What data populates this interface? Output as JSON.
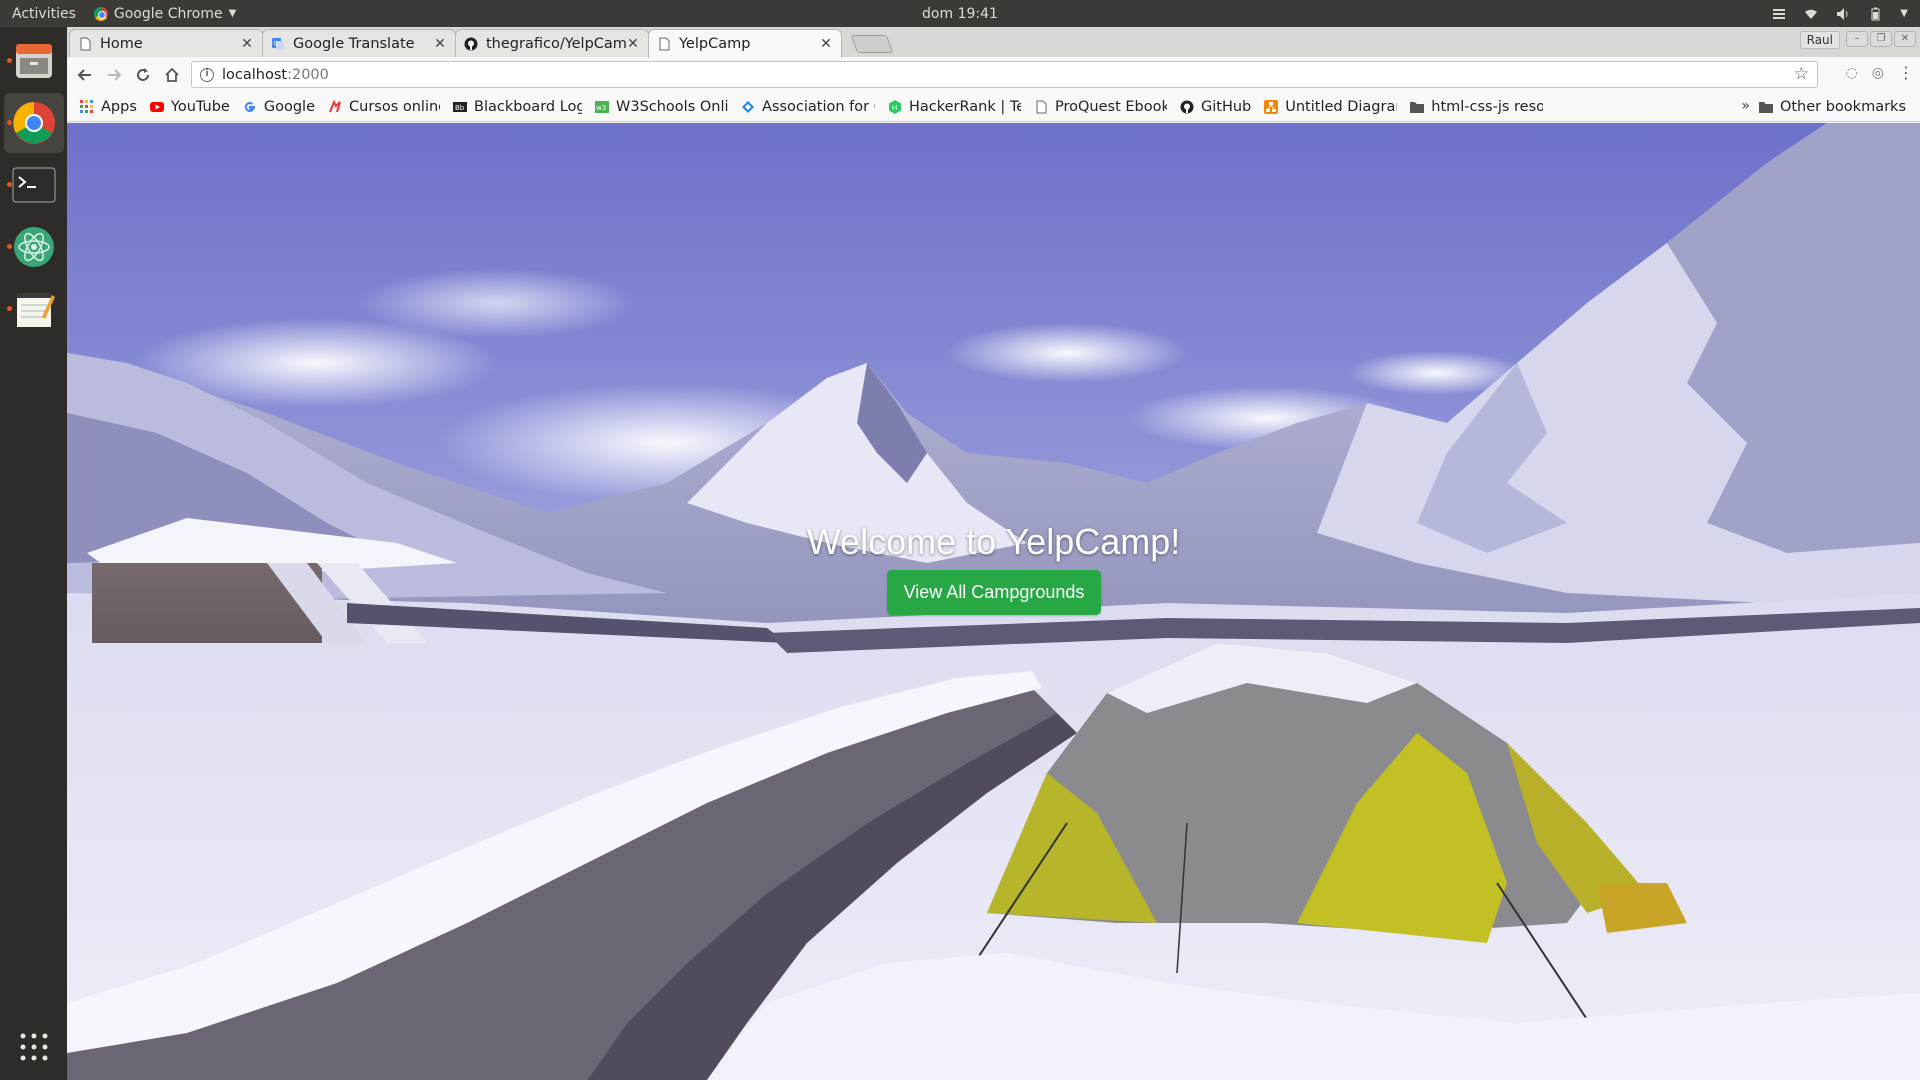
{
  "system": {
    "activities": "Activities",
    "app_menu": "Google Chrome",
    "clock": "dom 19:41"
  },
  "browser": {
    "tabs": [
      {
        "title": "Home"
      },
      {
        "title": "Google Translate"
      },
      {
        "title": "thegrafico/YelpCam"
      },
      {
        "title": "YelpCamp",
        "active": true
      }
    ],
    "profile": "Raul",
    "url_host": "localhost",
    "url_port": ":2000",
    "bookmarks": [
      {
        "label": "Apps",
        "icon": "apps-grid-icon",
        "color": "#e8453c"
      },
      {
        "label": "YouTube",
        "icon": "youtube-icon",
        "color": "#ff0000"
      },
      {
        "label": "Google",
        "icon": "google-icon",
        "color": "#4285f4"
      },
      {
        "label": "Cursos online - e",
        "icon": "cursos-icon",
        "color": "#e53935"
      },
      {
        "label": "Blackboard Logi",
        "icon": "blackboard-icon",
        "color": "#222222"
      },
      {
        "label": "W3Schools Onli",
        "icon": "w3schools-icon",
        "color": "#4caf50"
      },
      {
        "label": "Association for C",
        "icon": "acm-icon",
        "color": "#1e88e5"
      },
      {
        "label": "HackerRank | Tec",
        "icon": "hackerrank-icon",
        "color": "#2ec866"
      },
      {
        "label": "ProQuest Ebook",
        "icon": "page-icon",
        "color": "#666666"
      },
      {
        "label": "GitHub",
        "icon": "github-icon",
        "color": "#222222"
      },
      {
        "label": "Untitled Diagran",
        "icon": "drawio-icon",
        "color": "#f08705"
      },
      {
        "label": "html-css-js resou",
        "icon": "folder-icon",
        "color": "#555555"
      }
    ],
    "more_bookmarks": "»",
    "other_bookmarks": "Other bookmarks"
  },
  "page": {
    "heading": "Welcome to YelpCamp!",
    "cta_label": "View All Campgrounds",
    "cta_color": "#28a745"
  }
}
